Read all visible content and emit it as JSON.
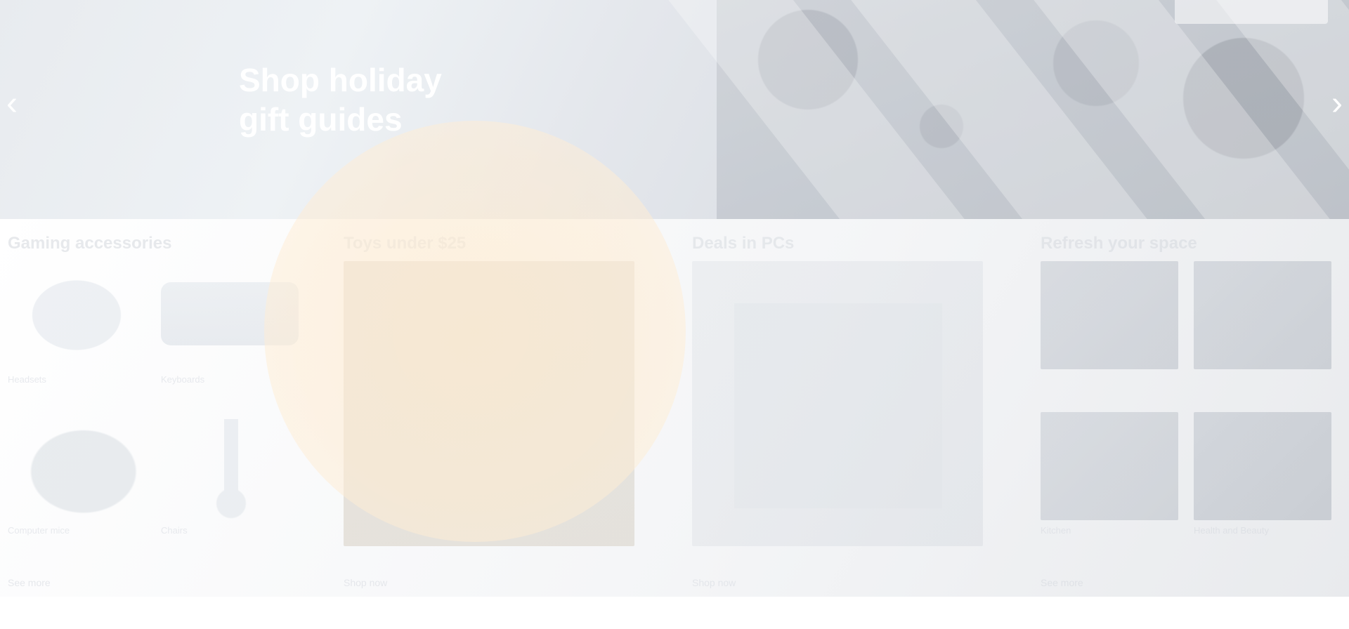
{
  "hero": {
    "title_line1": "Shop holiday",
    "title_line2": "gift guides"
  },
  "cards": [
    {
      "title": "Gaming accessories",
      "items": [
        {
          "label": "Headsets"
        },
        {
          "label": "Keyboards"
        },
        {
          "label": "Computer mice"
        },
        {
          "label": "Chairs"
        }
      ],
      "link": "See more"
    },
    {
      "title": "Toys under $25",
      "link": "Shop now"
    },
    {
      "title": "Deals in PCs",
      "link": "Shop now"
    },
    {
      "title": "Refresh your space",
      "items": [
        {
          "label": ""
        },
        {
          "label": ""
        },
        {
          "label": "Kitchen"
        },
        {
          "label": "Health and Beauty"
        }
      ],
      "link": "See more"
    }
  ]
}
